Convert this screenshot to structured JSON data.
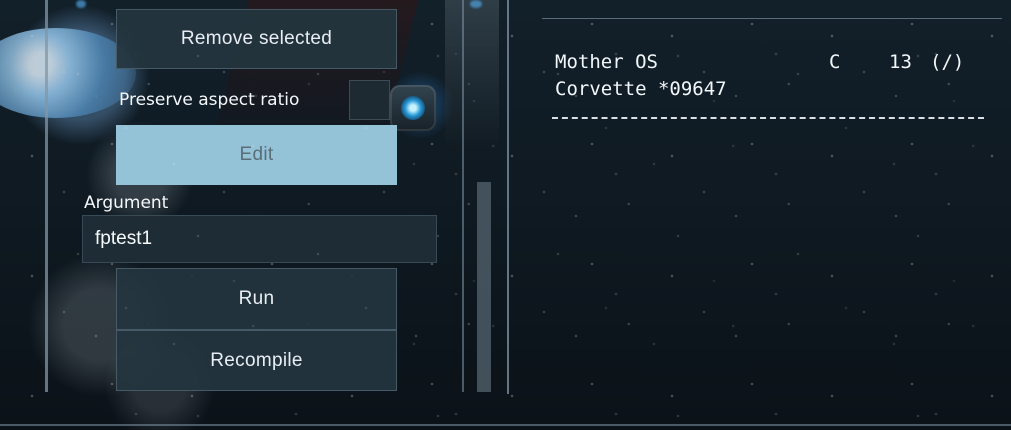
{
  "buttons": {
    "remove_selected": "Remove selected",
    "edit": "Edit",
    "run": "Run",
    "recompile": "Recompile"
  },
  "options": {
    "preserve_aspect_ratio": "Preserve aspect ratio",
    "preserve_aspect_ratio_checked": false
  },
  "argument": {
    "label": "Argument",
    "value": "fptest1"
  },
  "console": {
    "line1_left": "Mother OS",
    "line1_right_c": "C",
    "line1_right_number": "13",
    "line1_right_mode": "(/)",
    "line2": "Corvette *09647"
  }
}
